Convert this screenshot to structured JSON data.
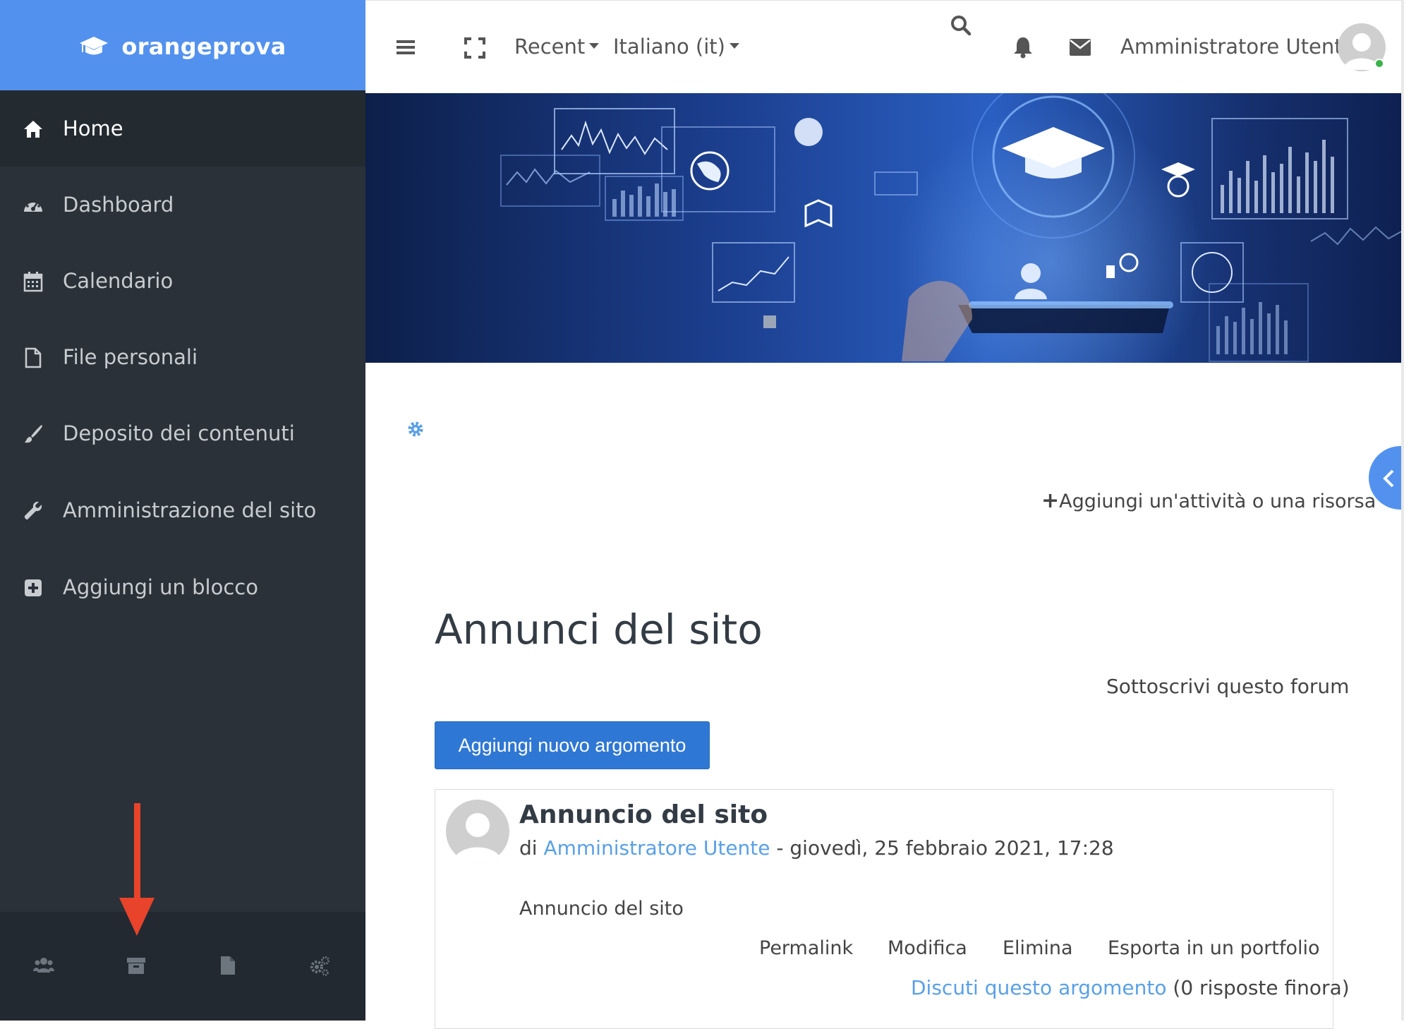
{
  "brand": {
    "name": "orangeprova"
  },
  "nav": [
    {
      "label": "Home",
      "icon": "home-icon"
    },
    {
      "label": "Dashboard",
      "icon": "dashboard-icon"
    },
    {
      "label": "Calendario",
      "icon": "calendar-icon"
    },
    {
      "label": "File personali",
      "icon": "file-icon"
    },
    {
      "label": "Deposito dei contenuti",
      "icon": "brush-icon"
    },
    {
      "label": "Amministrazione del sito",
      "icon": "wrench-icon"
    },
    {
      "label": "Aggiungi un blocco",
      "icon": "plus-square-icon"
    }
  ],
  "footer_icons": [
    "users-icon",
    "archive-icon",
    "document-icon",
    "cogs-icon"
  ],
  "topbar": {
    "recent": "Recent",
    "language": "Italiano (it)",
    "user_name": "Amministratore Utente"
  },
  "content": {
    "add_activity": "Aggiungi un'attività o una risorsa",
    "title": "Annunci del sito",
    "subscribe": "Sottoscrivi questo forum",
    "new_topic_button": "Aggiungi nuovo argomento",
    "post": {
      "title": "Annuncio del sito",
      "by": "di",
      "author": "Amministratore Utente",
      "date": "- giovedì, 25 febbraio 2021, 17:28",
      "body": "Annuncio del sito",
      "actions": [
        "Permalink",
        "Modifica",
        "Elimina",
        "Esporta in un portfolio"
      ],
      "discuss": "Discuti questo argomento",
      "replies": "(0 risposte finora)"
    }
  },
  "colors": {
    "brand": "#5391ee",
    "sidebar": "#2a3138",
    "link": "#5aa0e6",
    "primary_button": "#2f77d4",
    "arrow": "#e8432b"
  }
}
